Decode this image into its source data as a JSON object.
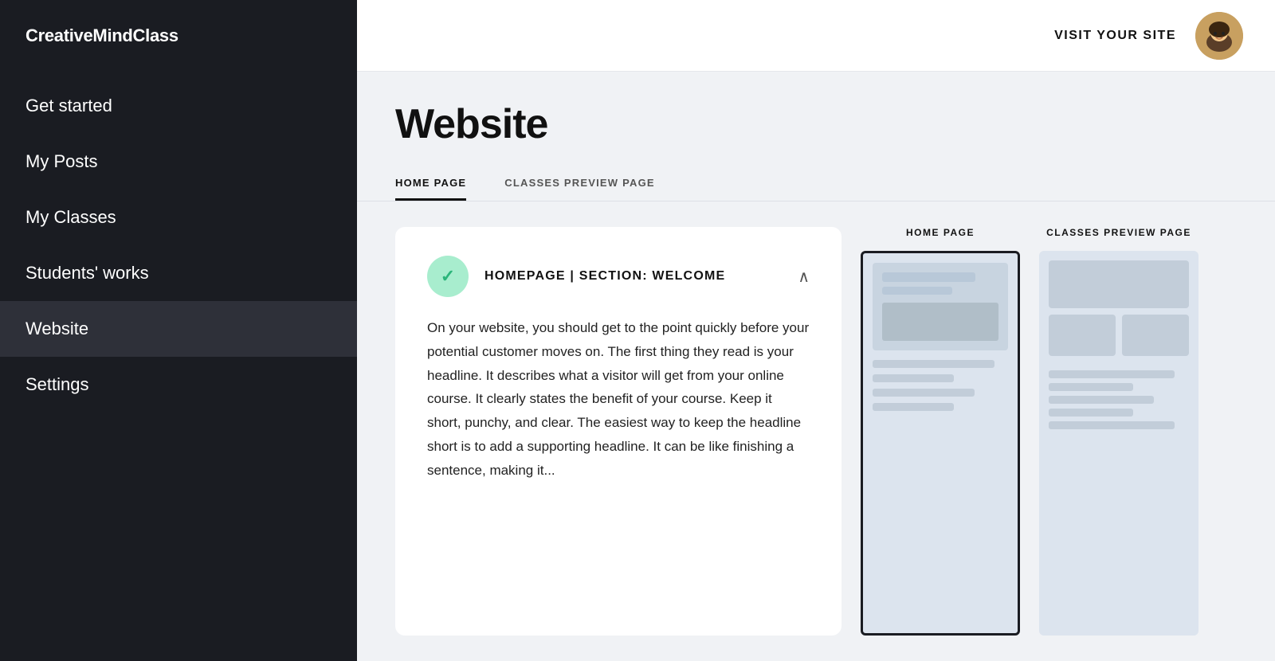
{
  "sidebar": {
    "logo": "CreativeMindClass",
    "items": [
      {
        "id": "get-started",
        "label": "Get started",
        "active": false
      },
      {
        "id": "my-posts",
        "label": "My Posts",
        "active": false
      },
      {
        "id": "my-classes",
        "label": "My Classes",
        "active": false
      },
      {
        "id": "students-works",
        "label": "Students' works",
        "active": false
      },
      {
        "id": "website",
        "label": "Website",
        "active": true
      },
      {
        "id": "settings",
        "label": "Settings",
        "active": false
      }
    ]
  },
  "topbar": {
    "visit_site_label": "VISIT YOUR SITE"
  },
  "page": {
    "title": "Website"
  },
  "tabs": [
    {
      "id": "home-page",
      "label": "HOME PAGE",
      "active": false
    },
    {
      "id": "classes-preview",
      "label": "CLASSES PREVIEW PAGE",
      "active": false
    }
  ],
  "info_card": {
    "section_label": "HOMEPAGE | Section: Welcome",
    "body_text": "On your website, you should get to the point quickly before your potential customer moves on. The first thing they read is your headline. It describes what a visitor will get from your online course. It clearly states the benefit of your course. Keep it short, punchy, and clear. The easiest way to keep the headline short is to add a supporting headline. It can be like finishing a sentence, making it..."
  },
  "preview_cols": [
    {
      "id": "home-page-preview",
      "label": "HOME PAGE"
    },
    {
      "id": "classes-preview-col",
      "label": "CLASSES PREVIEW PAGE"
    }
  ]
}
